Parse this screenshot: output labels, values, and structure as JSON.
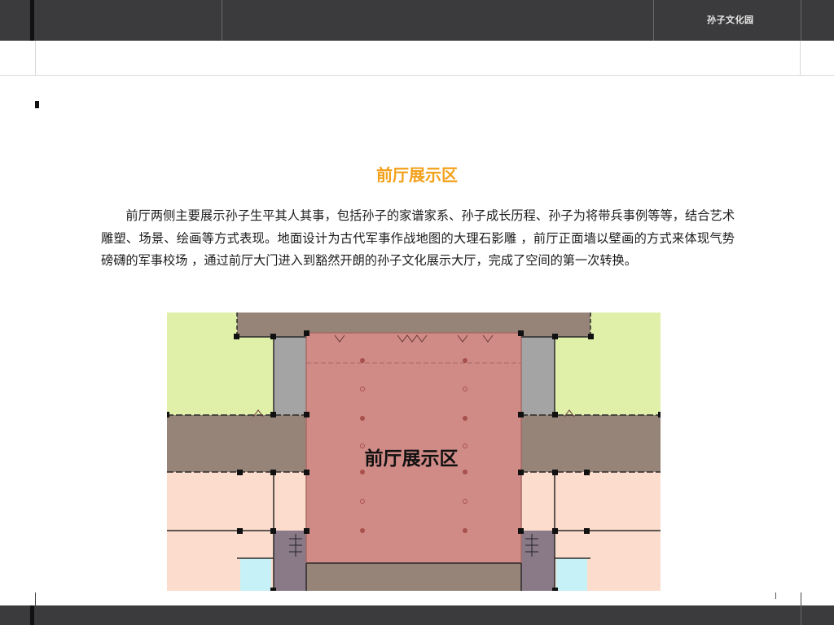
{
  "header": {
    "brand": "孙子文化园"
  },
  "section": {
    "title": "前厅展示区",
    "paragraph": "前厅两侧主要展示孙子生平其人其事，包括孙子的家谱家系、孙子成长历程、孙子为将带兵事例等等，结合艺术雕塑、场景、绘画等方式表现。地面设计为古代军事作战地图的大理石影雕 ，前厅正面墙以壁画的方式来体现气势磅礴的军事校场 ，通过前厅大门进入到豁然开朗的孙子文化展示大厅，完成了空间的第一次转换。"
  },
  "plan": {
    "label": "前厅展示区",
    "colors": {
      "hall": "#d08b87",
      "corridor": "#958477",
      "green": "#e0f0a8",
      "peach": "#fcdccc",
      "gray": "#a4a4a4",
      "stair": "#8a7a88",
      "cyan": "#c6f1f6"
    }
  }
}
